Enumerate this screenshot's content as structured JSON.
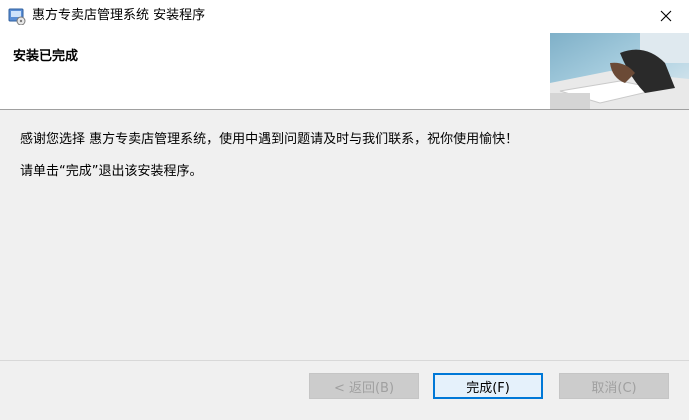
{
  "window": {
    "title": "惠方专卖店管理系统 安装程序",
    "close_symbol": "✕"
  },
  "banner": {
    "heading": "安装已完成"
  },
  "content": {
    "line1": "感谢您选择 惠方专卖店管理系统，使用中遇到问题请及时与我们联系，祝你使用愉快！",
    "line2": "请单击“完成”退出该安装程序。"
  },
  "buttons": {
    "back": "< 返回(B)",
    "finish": "完成(F)",
    "cancel": "取消(C)"
  },
  "colors": {
    "accent": "#0078d7",
    "window_bg": "#f0f0f0",
    "disabled_text": "#a0a0a0"
  }
}
